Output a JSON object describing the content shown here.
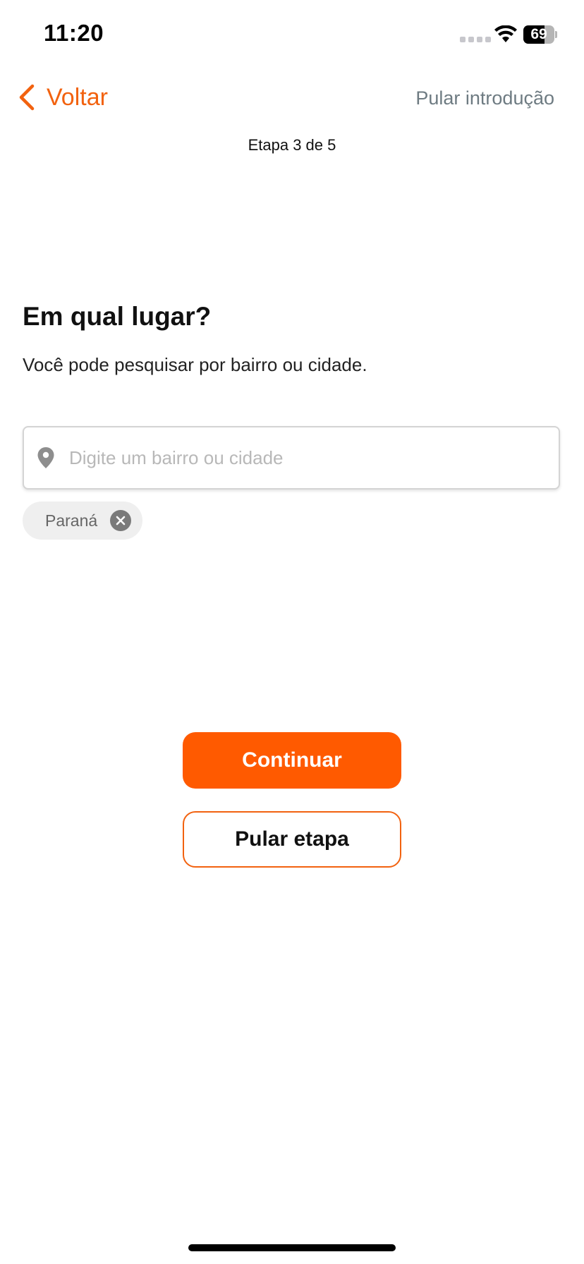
{
  "status_bar": {
    "time": "11:20",
    "battery_level": "69",
    "icons": [
      "cellular-signal-icon",
      "wifi-icon",
      "battery-icon"
    ]
  },
  "nav": {
    "back_label": "Voltar",
    "skip_intro_label": "Pular introdução",
    "step_text": "Etapa 3 de 5"
  },
  "content": {
    "title": "Em qual lugar?",
    "subtitle": "Você pode pesquisar por bairro ou cidade.",
    "search": {
      "placeholder": "Digite um bairro ou cidade",
      "value": ""
    },
    "chips": [
      {
        "label": "Paraná"
      }
    ]
  },
  "actions": {
    "continue_label": "Continuar",
    "skip_step_label": "Pular etapa"
  },
  "colors": {
    "accent": "#ff5a00",
    "accent_text": "#f2620f",
    "muted_link": "#6e7b82",
    "chip_bg": "#efefef"
  }
}
